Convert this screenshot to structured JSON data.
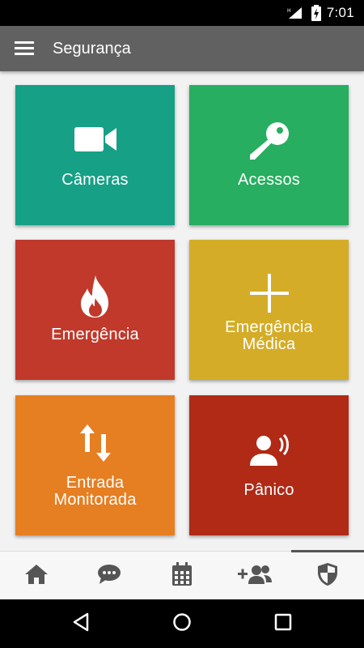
{
  "status_bar": {
    "time": "7:01",
    "signal_icon": "signal-icon",
    "battery_icon": "battery-charging-icon"
  },
  "app_bar": {
    "title": "Segurança",
    "menu_icon": "hamburger-menu-icon"
  },
  "tiles": [
    {
      "label": "Câmeras",
      "color": "#16a085",
      "icon": "video-camera-icon"
    },
    {
      "label": "Acessos",
      "color": "#27ae60",
      "icon": "key-icon"
    },
    {
      "label": "Emergência",
      "color": "#c0392b",
      "icon": "fire-icon"
    },
    {
      "label": "Emergência\nMédica",
      "line1": "Emergência",
      "line2": "Médica",
      "color": "#d4ac27",
      "icon": "plus-icon"
    },
    {
      "label": "Entrada\nMonitorada",
      "line1": "Entrada",
      "line2": "Monitorada",
      "color": "#e67e22",
      "icon": "up-down-arrows-icon"
    },
    {
      "label": "Pânico",
      "color": "#b02a16",
      "icon": "panic-speaker-icon"
    }
  ],
  "bottom_nav": [
    {
      "icon": "home-icon",
      "active": false
    },
    {
      "icon": "chat-icon",
      "active": false
    },
    {
      "icon": "calendar-icon",
      "active": false
    },
    {
      "icon": "add-user-icon",
      "active": false
    },
    {
      "icon": "shield-icon",
      "active": true
    }
  ],
  "colors": {
    "app_bar": "#616161",
    "status_bar": "#000000",
    "icon_gray": "#555555"
  }
}
